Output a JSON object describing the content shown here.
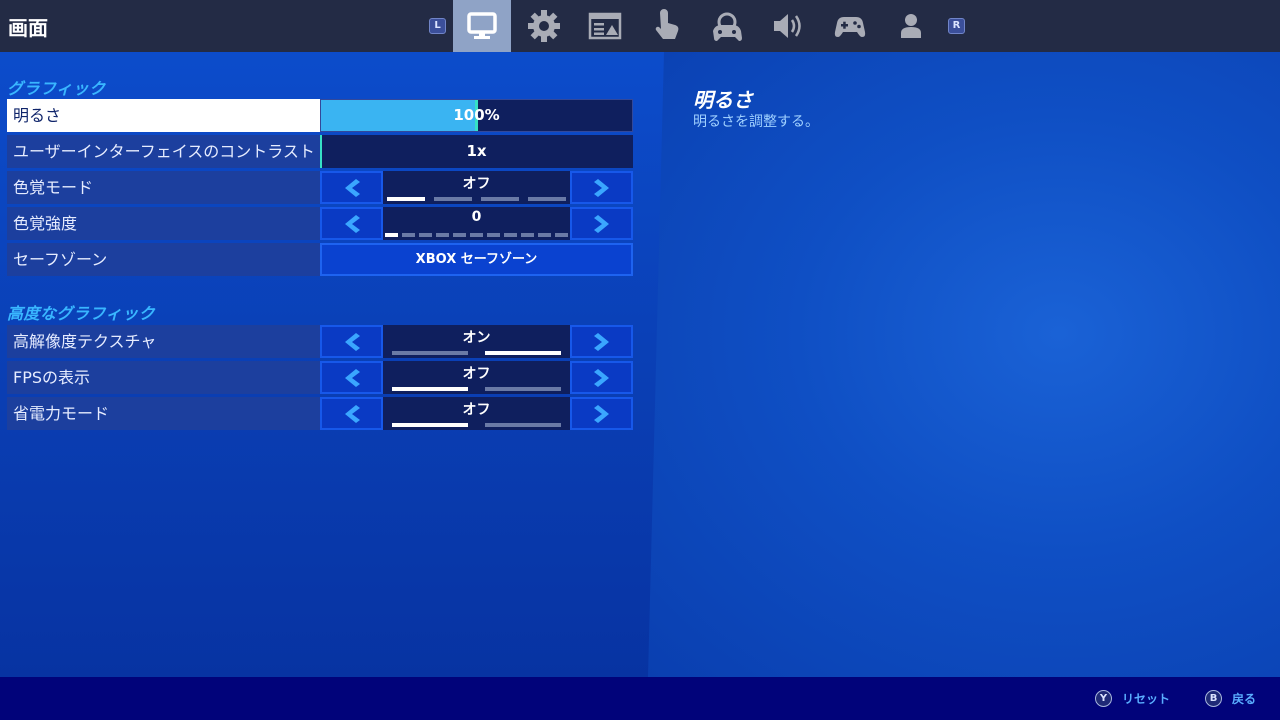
{
  "header": {
    "title": "画面",
    "shoulder_left": "L",
    "shoulder_right": "R",
    "tabs": [
      {
        "icon": "monitor-icon",
        "active": true
      },
      {
        "icon": "gear-icon",
        "active": false
      },
      {
        "icon": "hud-layout-icon",
        "active": false
      },
      {
        "icon": "touch-icon",
        "active": false
      },
      {
        "icon": "controller-gear-icon",
        "active": false
      },
      {
        "icon": "speaker-icon",
        "active": false
      },
      {
        "icon": "gamepad-icon",
        "active": false
      },
      {
        "icon": "account-icon",
        "active": false
      }
    ]
  },
  "graphics": {
    "title": "グラフィック",
    "brightness": {
      "label": "明るさ",
      "value": "100%",
      "fraction": 0.5
    },
    "contrast": {
      "label": "ユーザーインターフェイスのコントラスト",
      "value": "1x"
    },
    "color_mode": {
      "label": "色覚モード",
      "value": "オフ",
      "options_count": 4,
      "selected_index": 0
    },
    "color_strength": {
      "label": "色覚強度",
      "value": "0",
      "options_count": 11,
      "selected_index": 0
    },
    "safe_zone": {
      "label": "セーフゾーン",
      "value": "XBOX セーフゾーン"
    }
  },
  "advanced": {
    "title": "高度なグラフィック",
    "hires_textures": {
      "label": "高解像度テクスチャ",
      "value": "オン",
      "options_count": 2,
      "selected_index": 1
    },
    "show_fps": {
      "label": "FPSの表示",
      "value": "オフ",
      "options_count": 2,
      "selected_index": 0
    },
    "power_saving": {
      "label": "省電力モード",
      "value": "オフ",
      "options_count": 2,
      "selected_index": 0
    }
  },
  "description": {
    "title": "明るさ",
    "text": "明るさを調整する。"
  },
  "footer": {
    "reset": {
      "button": "Y",
      "label": "リセット"
    },
    "back": {
      "button": "B",
      "label": "戻る"
    }
  },
  "colors": {
    "accent": "#39b6ff",
    "slider_fill": "#3ab4f2",
    "selected_row": "#ffffff"
  }
}
